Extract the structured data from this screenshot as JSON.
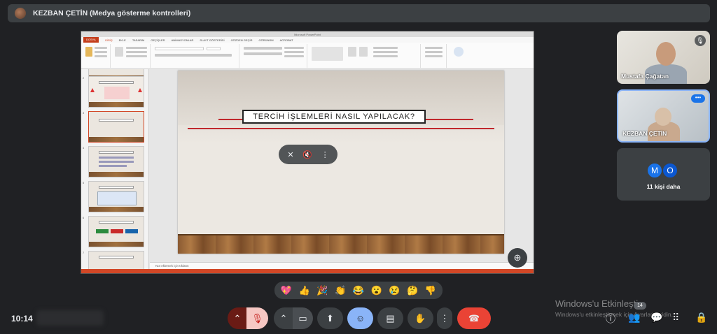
{
  "topbar": {
    "title": "KEZBAN ÇETİN (Medya gösterme kontrolleri)"
  },
  "ppt": {
    "window_title": "Microsoft PowerPoint",
    "tabs": [
      "DOSYA",
      "GİRİŞ",
      "EKLE",
      "TASARIM",
      "GEÇİŞLER",
      "ANİMASYONLAR",
      "SLAYT GÖSTERİSİ",
      "GÖZDEN GEÇİR",
      "GÖRÜNÜM",
      "ACROBAT"
    ],
    "notes_placeholder": "Not eklemek için tıklatın",
    "thumb_numbers": [
      "2",
      "3",
      "4",
      "5",
      "6",
      "7"
    ]
  },
  "slide": {
    "title": "TERCİH İŞLEMLERİ NASIL YAPILACAK?"
  },
  "media_controls": {
    "icons": [
      "pin-off-icon",
      "volume-off-icon",
      "more-vert-icon"
    ]
  },
  "participants": [
    {
      "name": "Mustafa Çağatan",
      "muted": true
    },
    {
      "name": "KEZBAN ÇETİN",
      "muted": false
    }
  ],
  "others": {
    "avatars": [
      {
        "letter": "M",
        "color": "#1a73e8"
      },
      {
        "letter": "O",
        "color": "#0b57d0"
      }
    ],
    "label": "11 kişi daha"
  },
  "reactions": [
    "💖",
    "👍",
    "🎉",
    "👏",
    "😂",
    "😮",
    "😢",
    "🤔",
    "👎"
  ],
  "bottom": {
    "time": "10:14",
    "participant_count": "14"
  },
  "watermark": {
    "line1": "Windows'u Etkinleştir",
    "line2": "Windows'u etkinleştirmek için Ayarlar'a gidin."
  }
}
